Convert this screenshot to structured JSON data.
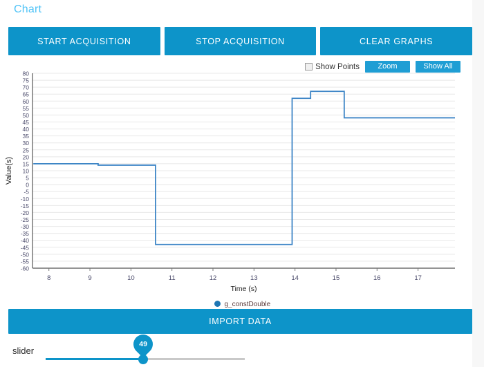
{
  "page_title": "Chart",
  "toolbar": {
    "start_label": "START ACQUISITION",
    "stop_label": "STOP ACQUISITION",
    "clear_label": "CLEAR GRAPHS"
  },
  "chart_toolbar": {
    "show_points_label": "Show Points",
    "show_points_checked": false,
    "zoom_label": "Zoom",
    "show_all_label": "Show All"
  },
  "import": {
    "label": "IMPORT DATA"
  },
  "slider": {
    "label": "slider",
    "value": 49,
    "min": 0,
    "max": 100,
    "display_value": "49"
  },
  "colors": {
    "accent": "#0d94c9",
    "small_button": "#1f9ed4",
    "title": "#4fc3f7",
    "series": "#3d85c6",
    "grid": "#e8e8e8",
    "axis": "#555555",
    "card_bg": "#ffffff",
    "page_bg": "#f7f7f7"
  },
  "chart_data": {
    "type": "line",
    "title": "",
    "xlabel": "Time (s)",
    "ylabel": "Value(s)",
    "xlim": [
      7.6,
      17.9
    ],
    "ylim": [
      -60,
      80
    ],
    "xticks": [
      8,
      9,
      10,
      11,
      12,
      13,
      14,
      15,
      16,
      17
    ],
    "yticks": [
      -60,
      -55,
      -50,
      -45,
      -40,
      -35,
      -30,
      -25,
      -20,
      -15,
      -10,
      -5,
      0,
      5,
      10,
      15,
      20,
      25,
      30,
      35,
      40,
      45,
      50,
      55,
      60,
      65,
      70,
      75,
      80
    ],
    "grid": true,
    "legend_position": "bottom",
    "step": true,
    "series": [
      {
        "name": "g_constDouble",
        "color": "#3d85c6",
        "x": [
          7.62,
          9.2,
          10.6,
          13.93,
          14.38,
          15.2,
          17.85
        ],
        "y": [
          15,
          14,
          -43,
          62,
          67,
          48,
          48
        ]
      }
    ]
  }
}
